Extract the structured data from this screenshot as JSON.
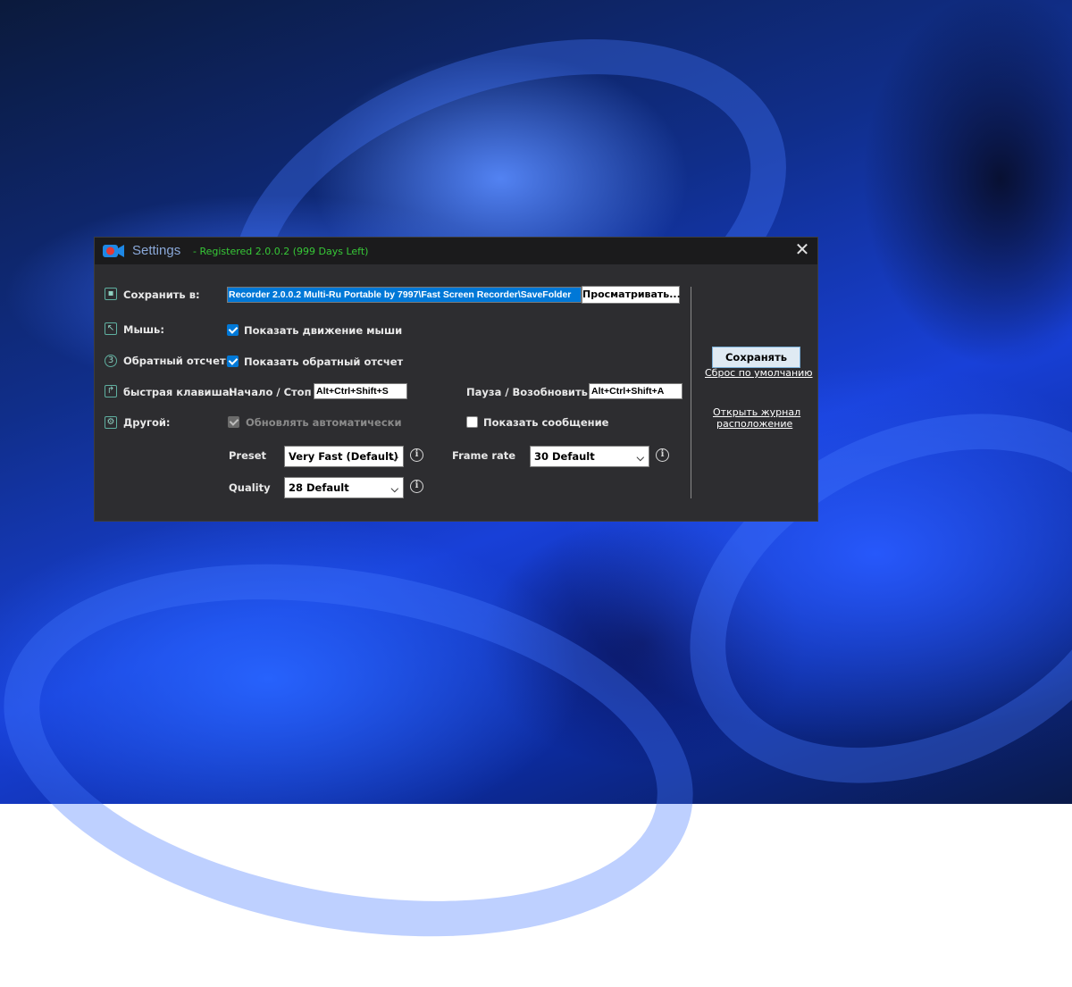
{
  "window": {
    "title": "Settings",
    "registration": "- Registered 2.0.0.2 (999 Days Left)",
    "close_glyph": "✕"
  },
  "save_to": {
    "label": "Сохранить в:",
    "path": "Recorder 2.0.0.2 Multi-Ru Portable by 7997\\Fast Screen Recorder\\SaveFolder",
    "browse_label": "Просматривать..."
  },
  "mouse": {
    "label": "Мышь:",
    "checkbox_label": "Показать движение мыши",
    "checked": true
  },
  "countdown": {
    "label": "Обратный отсчет:",
    "checkbox_label": "Показать обратный отсчет",
    "checked": true
  },
  "hotkey": {
    "label": "быстрая клавиша:",
    "start_stop_label": "Начало / Стоп",
    "start_stop_value": "Alt+Ctrl+Shift+S",
    "pause_label": "Пауза / Возобновить",
    "pause_value": "Alt+Ctrl+Shift+A"
  },
  "other": {
    "label": "Другой:",
    "auto_update_label": "Обновлять автоматически",
    "auto_update_checked": true,
    "auto_update_disabled": true,
    "show_message_label": "Показать сообщение",
    "show_message_checked": false
  },
  "encoding": {
    "preset_label": "Preset",
    "preset_value": "Very Fast (Default)",
    "framerate_label": "Frame rate",
    "framerate_value": "30 Default",
    "quality_label": "Quality",
    "quality_value": "28 Default"
  },
  "side": {
    "save_button": "Сохранять",
    "reset_link": "Сброс по умолчанию",
    "open_log_line1": "Открыть журнал",
    "open_log_line2": "расположение"
  },
  "icons": {
    "app": "camera-icon",
    "save": "floppy-icon",
    "mouse": "cursor-icon",
    "countdown": "countdown-icon",
    "hotkey": "arrow-icon",
    "other": "gear-icon",
    "info": "info-icon",
    "dropdown": "chevron-down-icon"
  },
  "colors": {
    "title_text": "#8aa8d8",
    "registered_text": "#37c837",
    "accent": "#0078d7",
    "window_bg": "#2d2d30",
    "titlebar_bg": "#1b1b1c"
  }
}
